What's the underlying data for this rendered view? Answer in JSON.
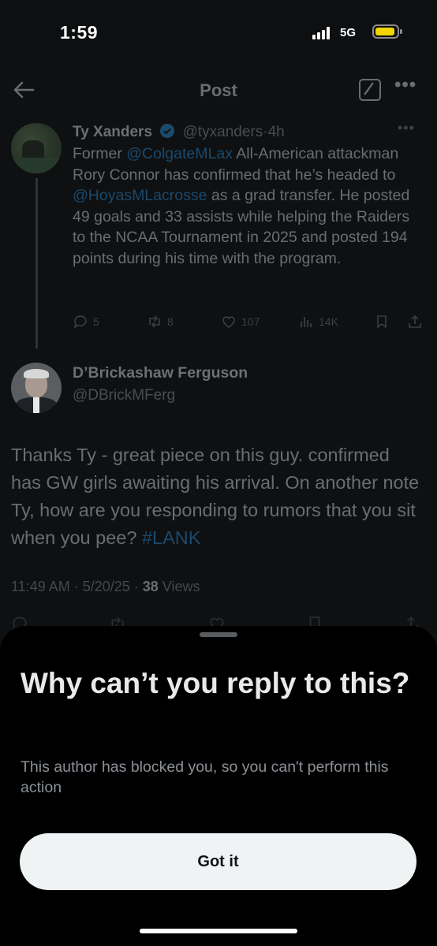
{
  "status_bar": {
    "time": "1:59",
    "network": "5G",
    "icons": [
      "signal-icon",
      "battery-icon"
    ],
    "battery_color": "#f2d600"
  },
  "header": {
    "title": "Post",
    "icons": [
      "back-arrow-icon",
      "compose-icon",
      "more-icon"
    ]
  },
  "parent_tweet": {
    "author_name": "Ty Xanders",
    "handle": "@tyxanders",
    "time": "4h",
    "separator": "·",
    "text_parts": {
      "p1": "Former ",
      "mention1": "@ColgateMLax",
      "p2": " All-American attackman Rory Connor has confirmed that he’s headed to ",
      "mention2": "@HoyasMLacrosse",
      "p3": " as a grad transfer. He posted 49 goals and 33 assists while helping the Raiders to the NCAA Tournament in 2025 and posted 194 points during his time with the program."
    },
    "stats": {
      "replies": "5",
      "reposts": "8",
      "likes": "107",
      "views": "14K"
    }
  },
  "reply": {
    "author_name": "D’Brickashaw Ferguson",
    "handle": "@DBrickMFerg",
    "text": "Thanks Ty - great piece on this guy. confirmed has GW girls awaiting his arrival. On another note Ty, how are you responding to rumors that you sit when you pee? ",
    "hashtag": "#LANK",
    "timestamp": "11:49 AM · 5/20/25 · ",
    "views_count": "38",
    "views_label": " Views"
  },
  "sheet": {
    "title": "Why can’t you reply to this?",
    "body": "This author has blocked you, so you can't perform this action",
    "button_label": "Got it"
  },
  "colors": {
    "link": "#1d9bf0",
    "background": "#000000",
    "button_bg": "#eff3f4"
  }
}
